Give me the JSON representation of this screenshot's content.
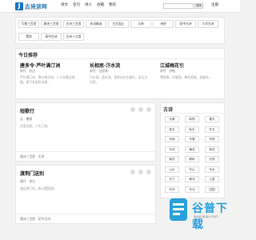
{
  "header": {
    "logo_char": "J",
    "logo_text": "古诗词网",
    "logo_sub": "GUSHICI WANG",
    "nav": [
      "诗文",
      "名句",
      "诗人",
      "古籍",
      "我的"
    ],
    "search_placeholder": "",
    "search_button": "搜索",
    "user": "注册"
  },
  "tags": [
    "写景三百首",
    "唐诗三百首",
    "古诗三百首",
    "宋词精选",
    "古文观止",
    "乐府",
    "诗经",
    "初中古诗",
    "小学古诗",
    "楚辞",
    "高中古诗",
    "古诗十九首"
  ],
  "recommend": {
    "heading": "今日推荐",
    "items": [
      {
        "title": "唐多令·芦叶满汀洲",
        "meta": "宋代　刘过",
        "body": "芦叶满汀洲，寒沙带浅流。二十年重过南楼。柳下系船犹未稳..."
      },
      {
        "title": "长相思·汴水流",
        "meta": "宋代　白居易",
        "body": "汴水流，泗水流，流到瓜州古渡头。吴山点点愁。"
      },
      {
        "title": "江城梅花引",
        "meta": "宋代　洪皓",
        "body": "雪欺春，早摧残。梅花欲放，还被风..."
      }
    ]
  },
  "poems": [
    {
      "title": "短歌行",
      "meta": "汉　曹操",
      "body": "对酒当歌，人生几何。",
      "tags": "唐诗三百首　乐府"
    },
    {
      "title": "渡荆门送别",
      "meta": "唐代　李白",
      "body": "渡远荆门外，来从楚国游。",
      "tags": "唐诗三百首　初中古诗"
    }
  ],
  "sidebar": {
    "heading": "古诗",
    "tags": [
      "写景",
      "咏物",
      "春天",
      "夏天",
      "秋天",
      "冬天",
      "写雨",
      "写雪",
      "写风",
      "写花",
      "梅花",
      "荷花",
      "菊花",
      "柳树",
      "月亮",
      "山水",
      "写山",
      "写水",
      "长江",
      "黄河",
      "儿童",
      "写鸟",
      "写马",
      "田园",
      "边塞",
      "地名",
      "节日",
      "春节",
      "元宵",
      "寒食"
    ]
  },
  "watermark": {
    "text": "谷普下载",
    "sub": "www.gupu.com"
  }
}
